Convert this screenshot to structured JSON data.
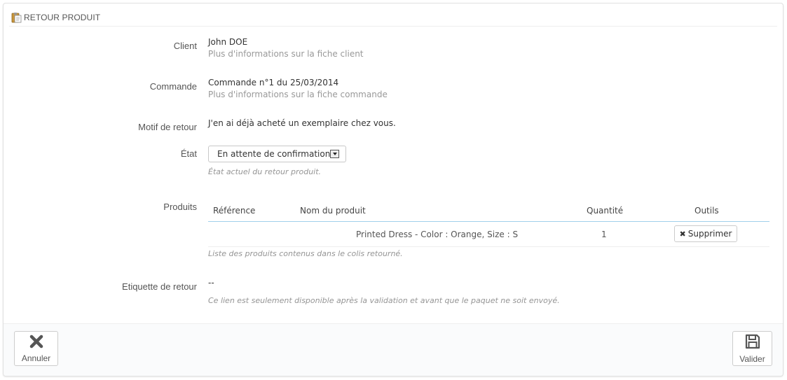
{
  "panel": {
    "title": "RETOUR PRODUIT",
    "icon": "clipboard-icon"
  },
  "fields": {
    "client": {
      "label": "Client",
      "value": "John DOE",
      "link": "Plus d'informations sur la fiche client"
    },
    "order": {
      "label": "Commande",
      "value": "Commande n°1 du 25/03/2014",
      "link": "Plus d'informations sur la fiche commande"
    },
    "reason": {
      "label": "Motif de retour",
      "value": "J'en ai déjà acheté un exemplaire chez vous."
    },
    "status": {
      "label": "État",
      "selected": "En attente de confirmation",
      "help": "État actuel du retour produit."
    },
    "products": {
      "label": "Produits",
      "columns": [
        "Référence",
        "Nom du produit",
        "Quantité",
        "Outils"
      ],
      "rows": [
        {
          "reference": "",
          "name": "Printed Dress - Color : Orange, Size : S",
          "quantity": "1",
          "action": "Supprimer"
        }
      ],
      "help": "Liste des produits contenus dans le colis retourné."
    },
    "label": {
      "label": "Etiquette de retour",
      "value": "--",
      "help": "Ce lien est seulement disponible après la validation et avant que le paquet ne soit envoyé."
    }
  },
  "footer": {
    "cancel_label": "Annuler",
    "cancel_icon": "close-icon",
    "save_label": "Valider",
    "save_icon": "save-icon"
  }
}
